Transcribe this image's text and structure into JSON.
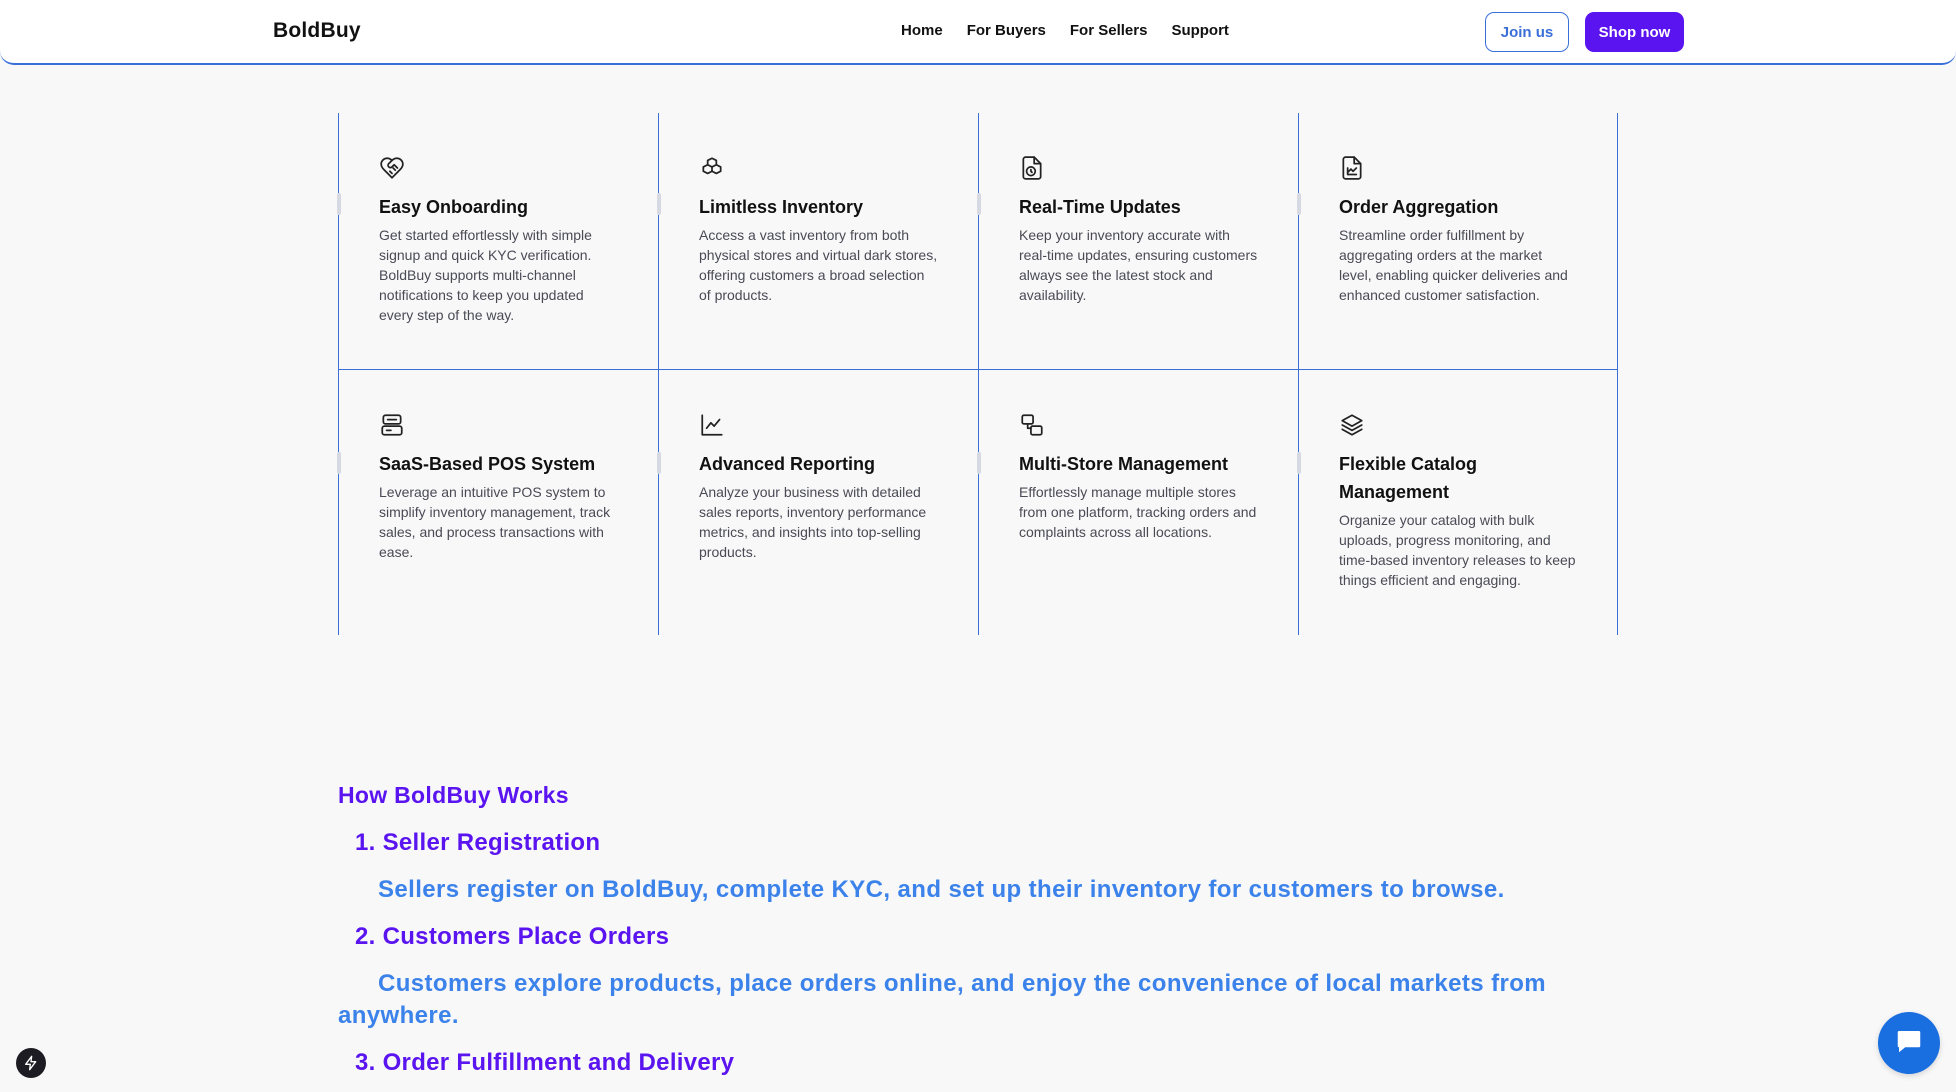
{
  "header": {
    "brand": "BoldBuy",
    "nav": [
      "Home",
      "For Buyers",
      "For Sellers",
      "Support"
    ],
    "join_label": "Join us",
    "shop_label": "Shop now"
  },
  "features": [
    {
      "icon": "heart-handshake-icon",
      "title": "Easy Onboarding",
      "desc": "Get started effortlessly with simple signup and quick KYC verification. BoldBuy supports multi-channel notifications to keep you updated every step of the way."
    },
    {
      "icon": "boxes-icon",
      "title": "Limitless Inventory",
      "desc": "Access a vast inventory from both physical stores and virtual dark stores, offering customers a broad selection of products."
    },
    {
      "icon": "file-clock-icon",
      "title": "Real-Time Updates",
      "desc": "Keep your inventory accurate with real-time updates, ensuring customers always see the latest stock and availability."
    },
    {
      "icon": "file-chart-icon",
      "title": "Order Aggregation",
      "desc": "Streamline order fulfillment by aggregating orders at the market level, enabling quicker deliveries and enhanced customer satisfaction."
    },
    {
      "icon": "server-icon",
      "title": "SaaS-Based POS System",
      "desc": "Leverage an intuitive POS system to simplify inventory management, track sales, and process transactions with ease."
    },
    {
      "icon": "line-chart-icon",
      "title": "Advanced Reporting",
      "desc": "Analyze your business with detailed sales reports, inventory performance metrics, and insights into top-selling products."
    },
    {
      "icon": "copy-icon",
      "title": "Multi-Store Management",
      "desc": "Effortlessly manage multiple stores from one platform, tracking orders and complaints across all locations."
    },
    {
      "icon": "layers-icon",
      "title": "Flexible Catalog Management",
      "desc": "Organize your catalog with bulk uploads, progress monitoring, and time-based inventory releases to keep things efficient and engaging."
    }
  ],
  "how": {
    "title": "How BoldBuy Works",
    "steps": [
      {
        "title": "1. Seller Registration",
        "desc": "Sellers register on BoldBuy, complete KYC, and set up their inventory for customers to browse."
      },
      {
        "title": "2. Customers Place Orders",
        "desc": "Customers explore products, place orders online, and enjoy the convenience of local markets from anywhere."
      },
      {
        "title": "3. Order Fulfillment and Delivery",
        "desc": ""
      }
    ]
  },
  "colors": {
    "accent_purple": "#5a14f0",
    "accent_blue": "#3b6fd8",
    "text_blue": "#3b82ea",
    "chat_blue": "#1a6fe0"
  }
}
